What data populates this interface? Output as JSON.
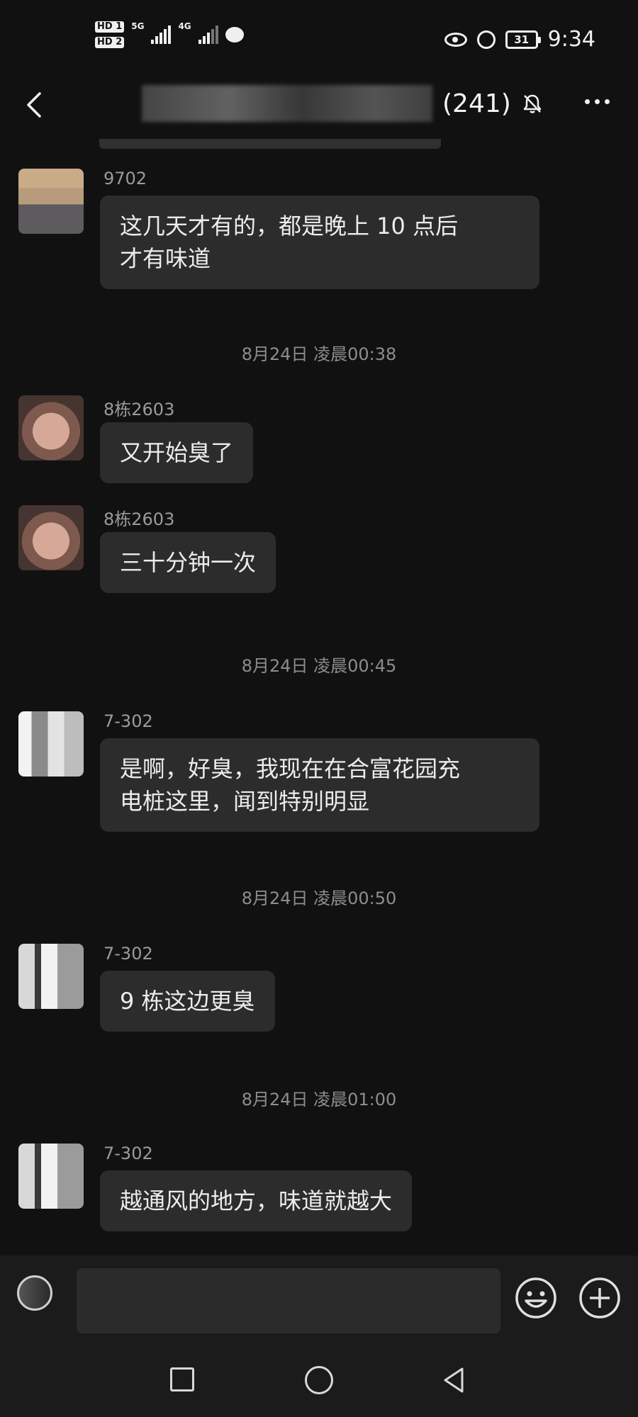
{
  "status_bar": {
    "hd1": "HD 1",
    "hd2": "HD 2",
    "net1": "5G",
    "net2": "4G",
    "battery": "31",
    "time": "9:34",
    "icons": [
      "signal-5g-icon",
      "signal-4g-icon",
      "message-icon",
      "eye-icon",
      "alarm-icon",
      "battery-icon"
    ]
  },
  "header": {
    "member_count": "(241)",
    "icons": [
      "back-icon",
      "mute-bell-icon",
      "more-icon"
    ]
  },
  "messages": [
    {
      "sender": "9702",
      "text_lines": [
        "这几天才有的，都是晚上 10 点后",
        "才有味道"
      ]
    },
    {
      "timestamp": "8月24日 凌晨00:38"
    },
    {
      "sender": "8栋2603",
      "text_lines": [
        "又开始臭了"
      ]
    },
    {
      "sender": "8栋2603",
      "text_lines": [
        "三十分钟一次"
      ]
    },
    {
      "timestamp": "8月24日 凌晨00:45"
    },
    {
      "sender": "7-302",
      "text_lines": [
        "是啊，好臭，我现在在合富花园充",
        "电桩这里，闻到特别明显"
      ]
    },
    {
      "timestamp": "8月24日 凌晨00:50"
    },
    {
      "sender": "7-302",
      "text_lines": [
        "9 栋这边更臭"
      ]
    },
    {
      "timestamp": "8月24日 凌晨01:00"
    },
    {
      "sender": "7-302",
      "text_lines": [
        "越通风的地方，味道就越大"
      ]
    }
  ],
  "input_bar": {
    "placeholder": "",
    "icons": [
      "voice-icon",
      "emoji-icon",
      "plus-icon"
    ]
  },
  "nav_bar": {
    "icons": [
      "recent-apps-icon",
      "home-icon",
      "back-nav-icon"
    ]
  },
  "colors": {
    "background": "#111111",
    "bubble": "#2c2c2c",
    "text": "#ececec",
    "secondary_text": "#8d8d8d"
  }
}
